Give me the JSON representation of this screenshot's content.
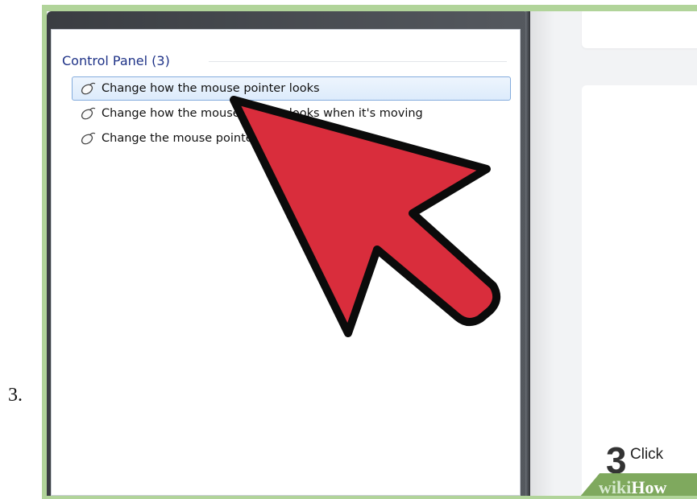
{
  "outer_step_label": "3.",
  "control_panel": {
    "header": "Control Panel (3)",
    "results": [
      {
        "label": "Change how the mouse pointer looks",
        "icon": "mouse-icon",
        "selected": true
      },
      {
        "label": "Change how the mouse pointer looks when it's moving",
        "icon": "mouse-icon",
        "selected": false
      },
      {
        "label": "Change the mouse pointer display or speed",
        "icon": "mouse-icon",
        "selected": false
      }
    ]
  },
  "right_panel": {
    "step_number": "3",
    "step_text": "Click"
  },
  "watermark": {
    "part1": "wiki",
    "part2": "How"
  },
  "colors": {
    "frame_green": "#b1d49a",
    "header_blue": "#1e3287",
    "selection_border": "#84acdd",
    "arrow_red": "#d92d3c"
  }
}
